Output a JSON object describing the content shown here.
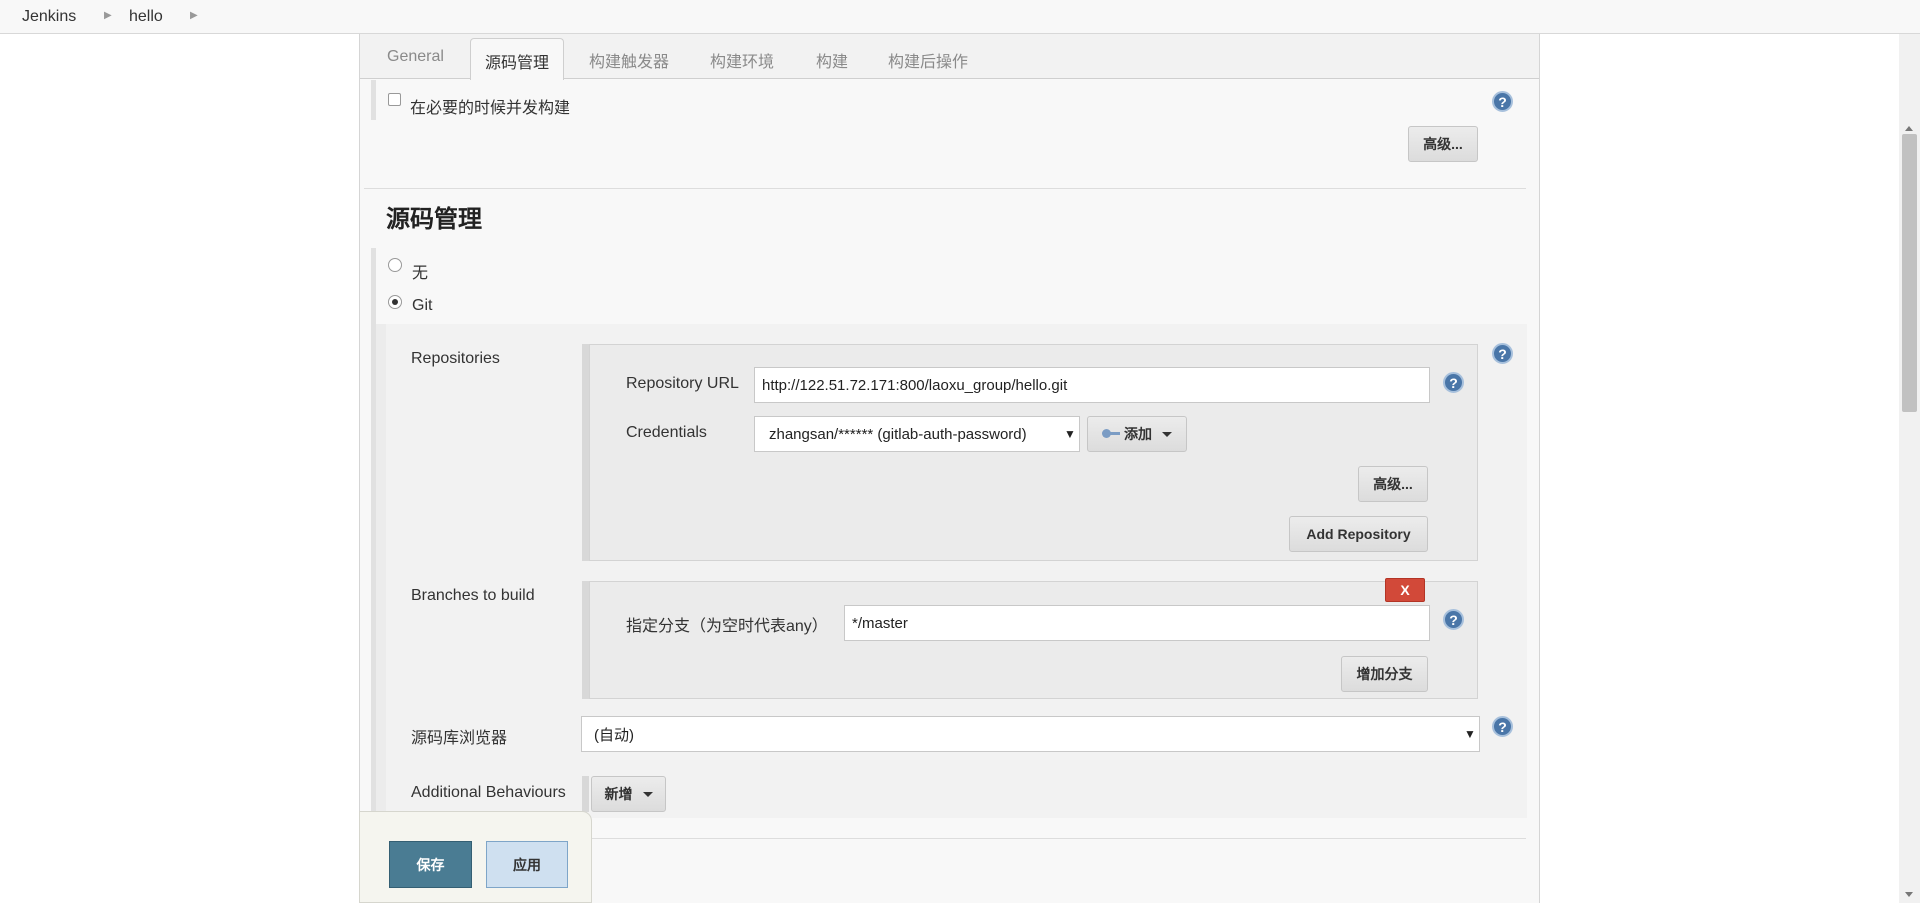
{
  "breadcrumb": [
    "Jenkins",
    "hello"
  ],
  "tabs": [
    "General",
    "源码管理",
    "构建触发器",
    "构建环境",
    "构建",
    "构建后操作"
  ],
  "general": {
    "concurrent_label": "在必要的时候并发构建",
    "advanced_label": "高级..."
  },
  "scm": {
    "title": "源码管理",
    "none_label": "无",
    "git_label": "Git",
    "repositories_label": "Repositories",
    "repo_url_label": "Repository URL",
    "repo_url_value": "http://122.51.72.171:800/laoxu_group/hello.git",
    "credentials_label": "Credentials",
    "credentials_value": "zhangsan/****** (gitlab-auth-password)",
    "add_label": "添加",
    "repo_advanced_label": "高级...",
    "add_repository_label": "Add Repository",
    "branches_label": "Branches to build",
    "delete_label": "X",
    "branch_spec_label": "指定分支（为空时代表any）",
    "branch_spec_value": "*/master",
    "add_branch_label": "增加分支",
    "browser_label": "源码库浏览器",
    "browser_value": "(自动)",
    "behaviours_label": "Additional Behaviours",
    "behaviours_add_label": "新增"
  },
  "footer": {
    "save_label": "保存",
    "apply_label": "应用"
  },
  "colors": {
    "save_button": "#4a7c93",
    "apply_button": "#cfe0f0",
    "delete_button": "#d24939",
    "help_icon": "#4a76a8"
  },
  "icons": [
    "chevron-right-icon",
    "help-icon",
    "key-icon",
    "caret-down-icon"
  ]
}
